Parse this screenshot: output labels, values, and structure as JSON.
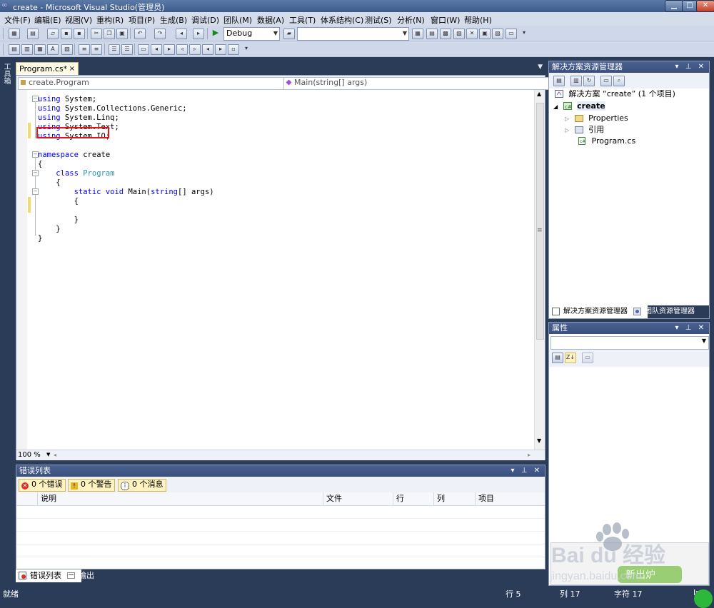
{
  "window": {
    "title": "create - Microsoft Visual Studio(管理员)",
    "controls": {
      "minimize": "▁",
      "maximize": "□",
      "close": "✕"
    }
  },
  "menu": {
    "items": [
      "文件(F)",
      "编辑(E)",
      "视图(V)",
      "重构(R)",
      "项目(P)",
      "生成(B)",
      "调试(D)",
      "团队(M)",
      "数据(A)",
      "工具(T)",
      "体系结构(C)",
      "测试(S)",
      "分析(N)",
      "窗口(W)",
      "帮助(H)"
    ]
  },
  "toolbar": {
    "config": "Debug",
    "platform": ""
  },
  "left_strip": {
    "toolbox": "工具箱"
  },
  "editor": {
    "tab_label": "Program.cs*",
    "tab_close": "×",
    "nav_left": "create.Program",
    "nav_right": "Main(string[] args)",
    "zoom": "100 %",
    "code": [
      [
        {
          "t": "using",
          "c": "kw"
        },
        {
          "t": " System;"
        }
      ],
      [
        {
          "t": "using",
          "c": "kw"
        },
        {
          "t": " System.Collections.Generic;"
        }
      ],
      [
        {
          "t": "using",
          "c": "kw"
        },
        {
          "t": " System.Linq;"
        }
      ],
      [
        {
          "t": "using",
          "c": "kw"
        },
        {
          "t": " System.Text;"
        }
      ],
      [
        {
          "t": "using",
          "c": "kw"
        },
        {
          "t": " System.IO;"
        }
      ],
      [],
      [
        {
          "t": "namespace",
          "c": "kw"
        },
        {
          "t": " create"
        }
      ],
      [
        {
          "t": "{"
        }
      ],
      [
        {
          "t": "    "
        },
        {
          "t": "class",
          "c": "kw"
        },
        {
          "t": " "
        },
        {
          "t": "Program",
          "c": "ty"
        }
      ],
      [
        {
          "t": "    {"
        }
      ],
      [
        {
          "t": "        "
        },
        {
          "t": "static",
          "c": "kw"
        },
        {
          "t": " "
        },
        {
          "t": "void",
          "c": "kw"
        },
        {
          "t": " Main("
        },
        {
          "t": "string",
          "c": "kw"
        },
        {
          "t": "[] args)"
        }
      ],
      [
        {
          "t": "        {"
        }
      ],
      [],
      [
        {
          "t": "        }"
        }
      ],
      [
        {
          "t": "    }"
        }
      ],
      [
        {
          "t": "}"
        }
      ]
    ]
  },
  "error_list": {
    "title": "错误列表",
    "filters": {
      "errors": "0 个错误",
      "warnings": "0 个警告",
      "messages": "0 个消息"
    },
    "columns": {
      "desc": "说明",
      "file": "文件",
      "line": "行",
      "col": "列",
      "project": "项目"
    }
  },
  "bottom_tabs": {
    "errors": "错误列表",
    "output": "输出"
  },
  "solution_explorer": {
    "title": "解决方案资源管理器",
    "solution": "解决方案 “create” (1 个项目)",
    "project": "create",
    "items": [
      "Properties",
      "引用",
      "Program.cs"
    ],
    "tabs": {
      "solution": "解决方案资源管理器",
      "team": "团队资源管理器"
    }
  },
  "properties": {
    "title": "属性"
  },
  "panel_controls": "▾ ⊥ ✕",
  "watermark": {
    "brand": "Bai du 经验",
    "url": "jingyan.baidu.com",
    "sub": "新出炉"
  },
  "status": {
    "ready": "就绪",
    "line": "行 5",
    "col": "列 17",
    "char": "字符 17",
    "mode": "Ins"
  },
  "colors": {
    "keyword": "#0000ff",
    "type": "#2b91af",
    "highlight": "#e0151b",
    "chrome": "#2b3c59"
  }
}
